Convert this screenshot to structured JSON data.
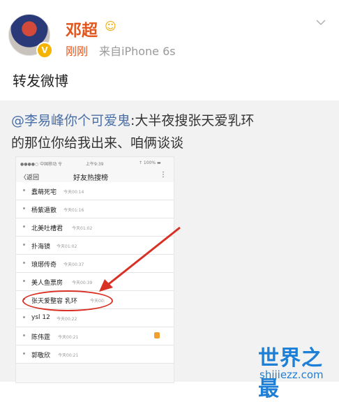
{
  "post": {
    "username": "邓超",
    "time": "刚刚",
    "source": "来自iPhone 6s",
    "action": "转发微博"
  },
  "quote": {
    "mention": "@李易峰你个可爱鬼",
    "text1": ":大半夜搜张天爱乳环",
    "text2": "的那位你给我出来、咱俩谈谈"
  },
  "phone": {
    "status_left": "●●●●○ 中国移动 令",
    "status_time": "上午9:39",
    "status_right": "↑ 100% ▬",
    "back_label": "〈返回",
    "title": "好友热搜榜",
    "more": "⋮",
    "rows": [
      {
        "text": "蠢萌死宅",
        "time": "今天00:14"
      },
      {
        "text": "杨紫遁散",
        "time": "今天01:16"
      },
      {
        "text": "北美吐槽君",
        "time": "今天01:02"
      },
      {
        "text": "扑海镜",
        "time": "今天01:02"
      },
      {
        "text": "琅琊传奇",
        "time": "今天00:37"
      },
      {
        "text": "美人鱼票房",
        "time": "今天00:39"
      },
      {
        "text": "张天爱整容 乳环",
        "time": "今天00:"
      },
      {
        "text": "ysl 12",
        "time": "今天00:22"
      },
      {
        "text": "陈伟霆",
        "time": "今天00:21"
      },
      {
        "text": "郭敬欣",
        "time": "今天00:21"
      }
    ]
  },
  "watermark": {
    "brand": "世界之最",
    "url": "shijiezz.com"
  },
  "colors": {
    "username": "#e2561c",
    "mention": "#4a6fa5",
    "annotation_red": "#d93025",
    "watermark": "#1d7fd6"
  },
  "icons": {
    "verified": "verified-badge-icon",
    "dropdown": "chevron-down-icon",
    "emoji": "laughing-emoji-icon"
  }
}
